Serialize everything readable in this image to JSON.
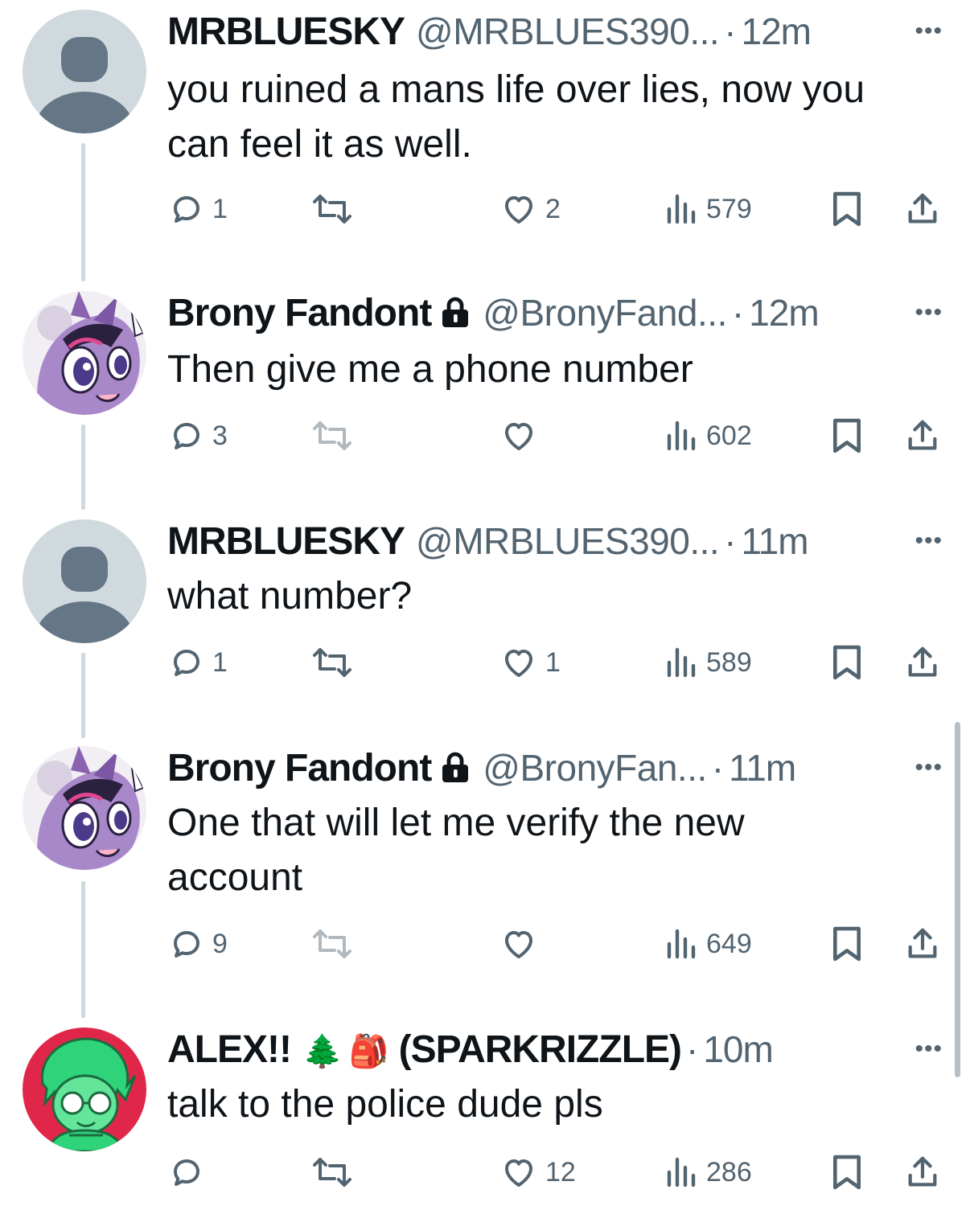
{
  "tweets": [
    {
      "name": "MRBLUESKY",
      "handle": "@MRBLUES390...",
      "time": "12m",
      "avatar": "default-avatar-icon",
      "text_lines": [
        "you ruined a mans life over lies, now you",
        "can feel it as well."
      ],
      "replies": "1",
      "reposts": "",
      "likes": "2",
      "views": "579",
      "locked": false
    },
    {
      "name": "Brony Fandont",
      "handle": "@BronyFand...",
      "time": "12m",
      "avatar": "pony-avatar-icon",
      "text_lines": [
        "Then give me a phone number"
      ],
      "replies": "3",
      "reposts": "",
      "likes": "",
      "views": "602",
      "locked": true
    },
    {
      "name": "MRBLUESKY",
      "handle": "@MRBLUES390...",
      "time": "11m",
      "avatar": "default-avatar-icon",
      "text_lines": [
        "what number?"
      ],
      "replies": "1",
      "reposts": "",
      "likes": "1",
      "views": "589",
      "locked": false
    },
    {
      "name": "Brony Fandont",
      "handle": "@BronyFan...",
      "time": "11m",
      "avatar": "pony-avatar-icon",
      "text_lines": [
        "One that will let me verify the new",
        "account"
      ],
      "replies": "9",
      "reposts": "",
      "likes": "",
      "views": "649",
      "locked": true
    },
    {
      "name": "ALEX!!",
      "name_suffix": "(SPARKRIZZLE)",
      "emojis": [
        "🌲",
        "🎒"
      ],
      "handle": "",
      "time": "10m",
      "avatar": "green-character-avatar-icon",
      "text_lines": [
        "talk to the police dude pls"
      ],
      "replies": "",
      "reposts": "",
      "likes": "12",
      "views": "286",
      "locked": false
    }
  ],
  "ui": {
    "separator": "·",
    "more_glyph": "•••"
  },
  "colors": {
    "text": "#0f1419",
    "secondary": "#536471",
    "thread_line": "#cfd9de",
    "default_avatar_bg": "#cfd9de",
    "default_avatar_fg": "#657786"
  }
}
